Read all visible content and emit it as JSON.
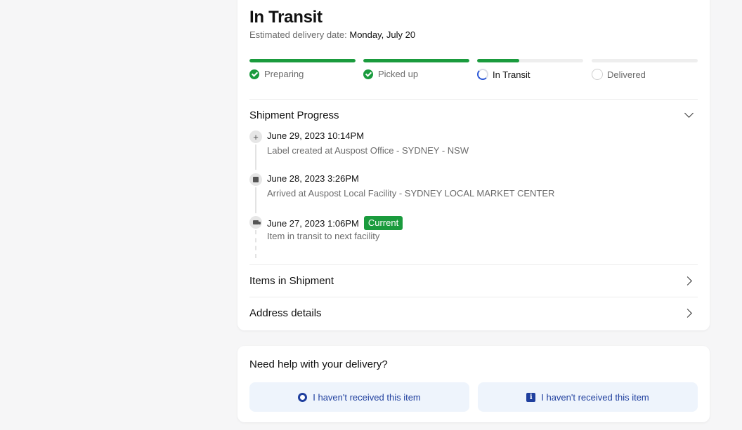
{
  "shipment": {
    "status_title": "In Transit",
    "estimated_label": "Estimated delivery date:",
    "estimated_date": "Monday, July 20"
  },
  "steps": [
    {
      "label": "Preparing",
      "state": "done",
      "progress": 1.0
    },
    {
      "label": "Picked up",
      "state": "done",
      "progress": 1.0
    },
    {
      "label": "In Transit",
      "state": "active",
      "progress": 0.4
    },
    {
      "label": "Delivered",
      "state": "pending",
      "progress": 0.0
    }
  ],
  "progress_section": {
    "title": "Shipment Progress",
    "events": [
      {
        "time": "June 29, 2023 10:14PM",
        "description": "Label created at Auspost Office - SYDNEY - NSW",
        "icon": "plus-icon"
      },
      {
        "time": "June 28, 2023 3:26PM",
        "description": "Arrived at Auspost Local Facility - SYDNEY LOCAL MARKET CENTER",
        "icon": "box-icon"
      },
      {
        "time": "June 27, 2023 1:06PM",
        "description": "Item in transit to next facility",
        "icon": "truck-icon",
        "badge": "Current"
      }
    ]
  },
  "sections": {
    "items_title": "Items in Shipment",
    "address_title": "Address details"
  },
  "help": {
    "title": "Need help with your delivery?",
    "buttons": [
      {
        "label": "I haven't received this item",
        "icon": "lifebuoy-icon"
      },
      {
        "label": "I haven't received this item",
        "icon": "info-icon"
      }
    ]
  },
  "colors": {
    "success": "#1a9b3d",
    "accent": "#1f3f9e",
    "muted_text": "#6b6b6b",
    "track": "#eeeeee"
  }
}
